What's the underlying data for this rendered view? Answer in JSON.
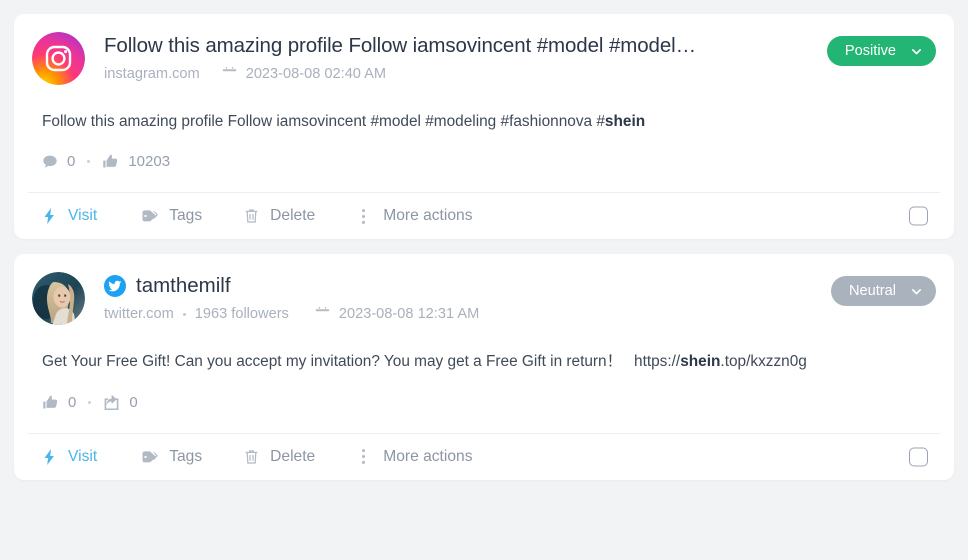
{
  "theme": {
    "page_bg": "#f2f3f5",
    "card_bg": "#ffffff",
    "positive_color": "#22b573",
    "neutral_color": "#aab2bd",
    "link_color": "#4cb4e7",
    "muted_text": "#a9b1bd",
    "body_text": "#3f4a57"
  },
  "posts": [
    {
      "id": "post-instagram",
      "avatar_icon": "instagram-logo-icon",
      "brand_icon": "",
      "title": "Follow this amazing profile Follow iamsovincent #model #model…",
      "domain": "instagram.com",
      "followers": "",
      "calendar_icon": "calendar-icon",
      "date": "2023-08-08 02:40 AM",
      "sentiment": {
        "label": "Positive",
        "color": "#22b573",
        "chevron_icon": "chevron-down-icon"
      },
      "body_prefix": "Follow this amazing profile Follow iamsovincent #model #modeling #fashionnova #",
      "body_highlight": "shein",
      "body_suffix": "",
      "stats": [
        {
          "icon": "comment-icon",
          "value": "0"
        },
        {
          "icon": "thumbs-up-icon",
          "value": "10203"
        }
      ],
      "actions": [
        {
          "icon": "bolt-icon",
          "label": "Visit"
        },
        {
          "icon": "tag-icon",
          "label": "Tags"
        },
        {
          "icon": "trash-icon",
          "label": "Delete"
        },
        {
          "icon": "dots-vertical-icon",
          "label": "More actions"
        }
      ],
      "checkbox_checked": false
    },
    {
      "id": "post-twitter",
      "avatar_icon": "user-photo-avatar",
      "brand_icon": "twitter-bird-icon",
      "title": "tamthemilf",
      "domain": "twitter.com",
      "followers": "1963 followers",
      "calendar_icon": "calendar-icon",
      "date": "2023-08-08 12:31 AM",
      "sentiment": {
        "label": "Neutral",
        "color": "#aab2bd",
        "chevron_icon": "chevron-down-icon"
      },
      "body_prefix": "Get Your Free Gift! Can you accept my invitation? You may get a Free Gift in return！",
      "body_url_prefix": "https://",
      "body_highlight": "shein",
      "body_suffix": ".top/kxzzn0g",
      "stats": [
        {
          "icon": "thumbs-up-icon",
          "value": "0"
        },
        {
          "icon": "share-icon",
          "value": "0"
        }
      ],
      "actions": [
        {
          "icon": "bolt-icon",
          "label": "Visit"
        },
        {
          "icon": "tag-icon",
          "label": "Tags"
        },
        {
          "icon": "trash-icon",
          "label": "Delete"
        },
        {
          "icon": "dots-vertical-icon",
          "label": "More actions"
        }
      ],
      "checkbox_checked": false
    }
  ]
}
